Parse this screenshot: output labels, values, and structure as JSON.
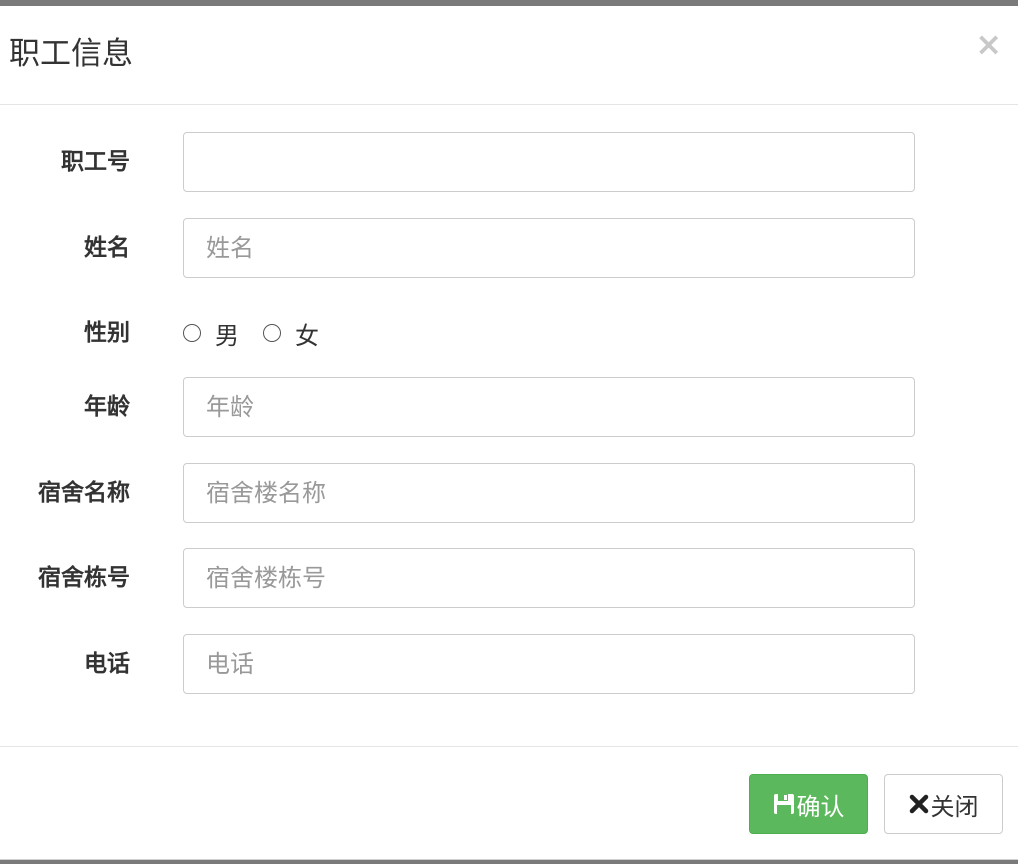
{
  "modal": {
    "title": "职工信息",
    "close_glyph": "×"
  },
  "form": {
    "employee_id": {
      "label": "职工号",
      "value": "",
      "placeholder": ""
    },
    "name": {
      "label": "姓名",
      "value": "",
      "placeholder": "姓名"
    },
    "gender": {
      "label": "性别",
      "options": [
        {
          "label": "男",
          "selected": false
        },
        {
          "label": "女",
          "selected": false
        }
      ]
    },
    "age": {
      "label": "年龄",
      "value": "",
      "placeholder": "年龄"
    },
    "dorm_name": {
      "label": "宿舍名称",
      "value": "",
      "placeholder": "宿舍楼名称"
    },
    "dorm_building_no": {
      "label": "宿舍栋号",
      "value": "",
      "placeholder": "宿舍楼栋号"
    },
    "phone": {
      "label": "电话",
      "value": "",
      "placeholder": "电话"
    }
  },
  "footer": {
    "confirm_label": "确认",
    "confirm_icon": "floppy-disk-icon",
    "close_label": "关闭",
    "close_icon": "x-icon"
  },
  "colors": {
    "confirm_bg": "#5cb85c",
    "text": "#333333",
    "placeholder": "#999999",
    "border": "#cccccc"
  }
}
